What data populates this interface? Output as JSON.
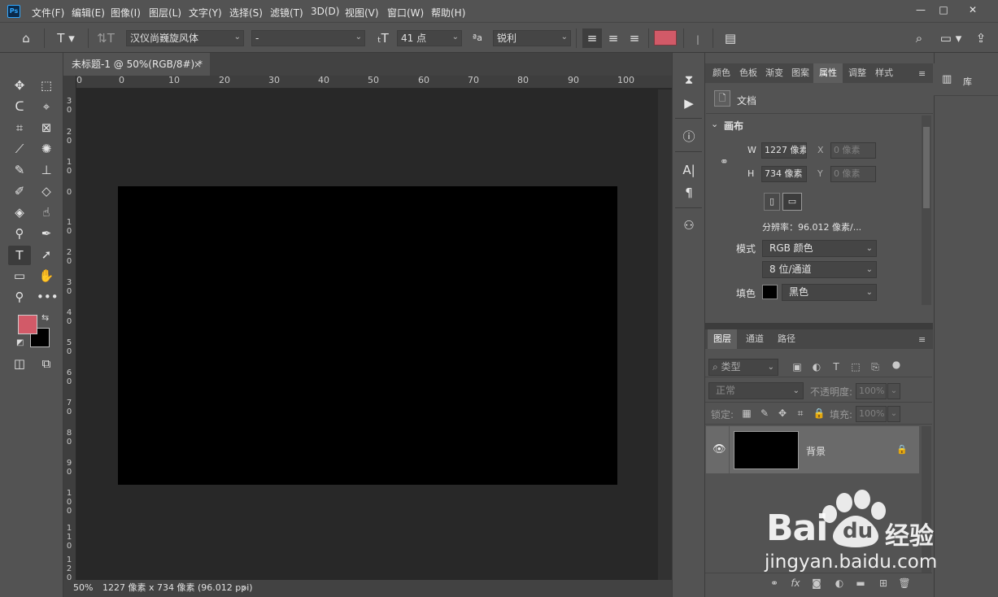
{
  "app": {
    "logo": "Ps"
  },
  "menu": [
    "文件(F)",
    "编辑(E)",
    "图像(I)",
    "图层(L)",
    "文字(Y)",
    "选择(S)",
    "滤镜(T)",
    "3D(D)",
    "视图(V)",
    "窗口(W)",
    "帮助(H)"
  ],
  "window_controls": {
    "minimize": "—",
    "maximize": "□",
    "close": "✕"
  },
  "options": {
    "font_family": "汉仪尚巍旋风体",
    "font_style": "-",
    "font_size": "41 点",
    "antialias_icon": "ªa",
    "antialias": "锐利",
    "text_color": "#d25a68"
  },
  "document": {
    "tab_title": "未标题-1 @ 50%(RGB/8#) *",
    "tab_close": "×",
    "canvas_color": "#000000"
  },
  "ruler": {
    "h_labels": [
      "0",
      "0",
      "10",
      "20",
      "30",
      "40",
      "50",
      "60",
      "70",
      "80",
      "90",
      "100"
    ],
    "v_labels": [
      "3\n0",
      "2\n0",
      "1\n0",
      "0",
      "1\n0",
      "2\n0",
      "3\n0",
      "4\n0",
      "5\n0",
      "6\n0",
      "7\n0",
      "8\n0",
      "9\n0",
      "1\n0\n0",
      "1\n1\n0",
      "1\n2\n0"
    ]
  },
  "status": {
    "zoom": "50%",
    "info": "1227 像素 x 734 像素 (96.012 ppi)",
    "arrow": "›"
  },
  "colors": {
    "foreground": "#d25a68",
    "background": "#000000"
  },
  "panel_tabs": [
    "颜色",
    "色板",
    "渐变",
    "图案",
    "属性",
    "调整",
    "样式"
  ],
  "properties": {
    "doc_label": "文档",
    "section": "画布",
    "w_label": "W",
    "w_value": "1227 像素",
    "h_label": "H",
    "h_value": "734 像素",
    "x_label": "X",
    "x_value": "0 像素",
    "y_label": "Y",
    "y_value": "0 像素",
    "resolution": "分辨率：96.012 像素/...",
    "mode_label": "模式",
    "mode_value": "RGB 颜色",
    "depth_value": "8 位/通道",
    "fill_label": "填色",
    "fill_value": "黑色"
  },
  "layers": {
    "tabs": [
      "图层",
      "通道",
      "路径"
    ],
    "filter_placeholder": "类型",
    "blend_mode": "正常",
    "opacity_label": "不透明度:",
    "opacity_value": "100%",
    "lock_label": "锁定:",
    "fill_label": "填充:",
    "fill_value": "100%",
    "items": [
      {
        "name": "背景"
      }
    ]
  },
  "library": {
    "label": "库"
  },
  "watermark": {
    "brand": "Bai",
    "du": "du",
    "cn": "经验",
    "url": "jingyan.baidu.com"
  }
}
